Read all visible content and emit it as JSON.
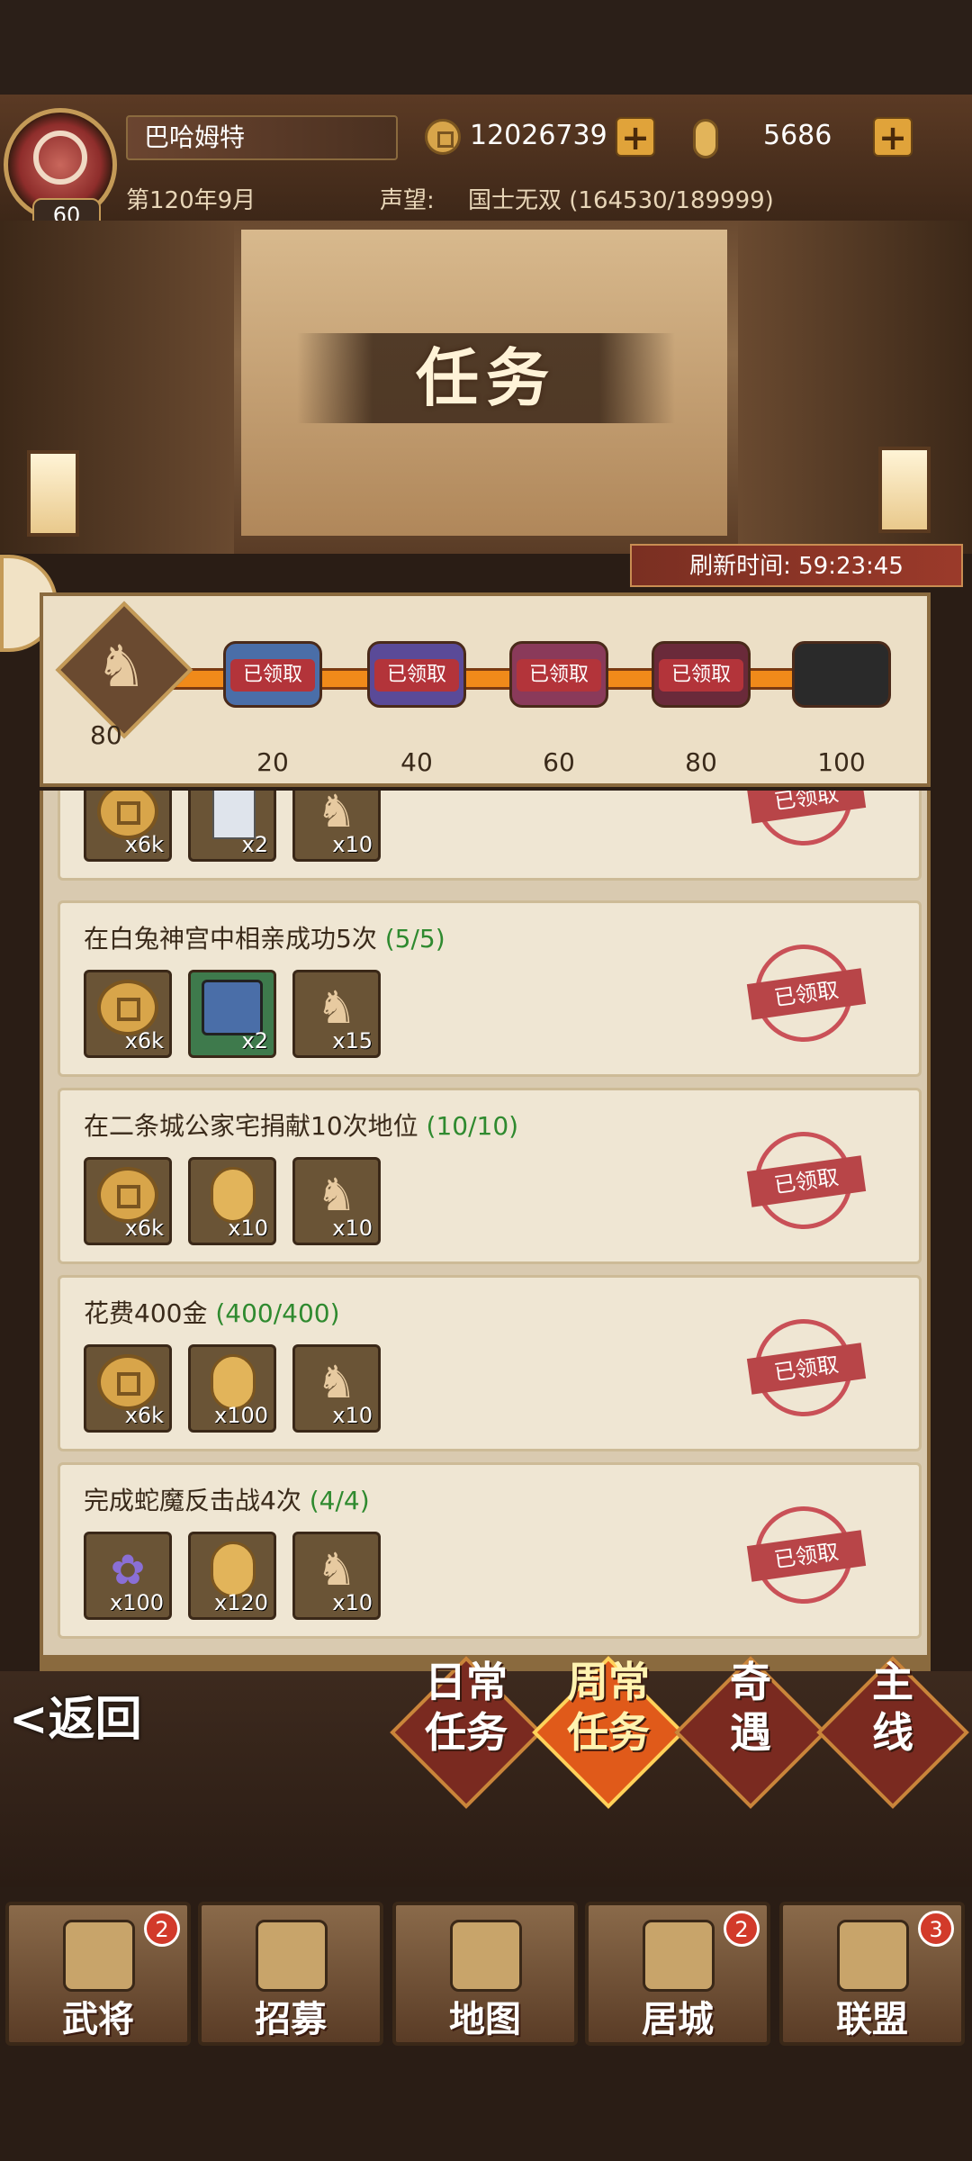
{
  "player": {
    "name": "巴哈姆特",
    "level": "60",
    "date": "第120年9月",
    "fame_label": "声望:",
    "fame_value": "国士无双 (164530/189999)"
  },
  "currency": {
    "gold": "12026739",
    "gold_icon": "coin-icon",
    "tickets": "5686",
    "tickets_icon": "gold-bar-icon"
  },
  "page_title": "任务",
  "refresh": "刷新时间: 59:23:45",
  "progress": {
    "current": "80",
    "milestones": [
      {
        "value": "20",
        "label": "已领取",
        "color": "#4a6ea8"
      },
      {
        "value": "40",
        "label": "已领取",
        "color": "#5a4a98"
      },
      {
        "value": "60",
        "label": "已领取",
        "color": "#8a3a5a"
      },
      {
        "value": "80",
        "label": "已领取",
        "color": "#6a2a3a"
      },
      {
        "value": "100",
        "label": "",
        "color": "#2a2a2a"
      }
    ]
  },
  "tasks": [
    {
      "title": "",
      "progress": "",
      "rewards": [
        {
          "type": "coin",
          "qty": "x6k"
        },
        {
          "type": "tag",
          "qty": "x2"
        },
        {
          "type": "horse",
          "qty": "x10"
        }
      ],
      "status": "已领取"
    },
    {
      "title": "在白兔神宫中相亲成功5次",
      "progress": "(5/5)",
      "rewards": [
        {
          "type": "coin",
          "qty": "x6k"
        },
        {
          "type": "chest",
          "qty": "x2"
        },
        {
          "type": "horse",
          "qty": "x15"
        }
      ],
      "status": "已领取"
    },
    {
      "title": "在二条城公家宅捐献10次地位",
      "progress": "(10/10)",
      "rewards": [
        {
          "type": "coin",
          "qty": "x6k"
        },
        {
          "type": "bar",
          "qty": "x10"
        },
        {
          "type": "horse",
          "qty": "x10"
        }
      ],
      "status": "已领取"
    },
    {
      "title": "花费400金",
      "progress": "(400/400)",
      "rewards": [
        {
          "type": "coin",
          "qty": "x6k"
        },
        {
          "type": "bar",
          "qty": "x100"
        },
        {
          "type": "horse",
          "qty": "x10"
        }
      ],
      "status": "已领取"
    },
    {
      "title": "完成蛇魔反击战4次",
      "progress": "(4/4)",
      "rewards": [
        {
          "type": "flower",
          "qty": "x100"
        },
        {
          "type": "bar",
          "qty": "x120"
        },
        {
          "type": "horse",
          "qty": "x10"
        }
      ],
      "status": "已领取"
    }
  ],
  "back_label": "<返回",
  "tabs": [
    {
      "label": "日常\n任务",
      "active": false
    },
    {
      "label": "周常\n任务",
      "active": true
    },
    {
      "label": "奇\n遇",
      "active": false
    },
    {
      "label": "主\n线",
      "active": false
    }
  ],
  "nav": [
    {
      "label": "武将",
      "badge": "2",
      "icon": "samurai-helmet-icon"
    },
    {
      "label": "招募",
      "badge": "",
      "icon": "sword-rack-icon"
    },
    {
      "label": "地图",
      "badge": "",
      "icon": "scroll-map-icon"
    },
    {
      "label": "居城",
      "badge": "2",
      "icon": "castle-icon"
    },
    {
      "label": "联盟",
      "badge": "3",
      "icon": "banner-icon"
    }
  ]
}
